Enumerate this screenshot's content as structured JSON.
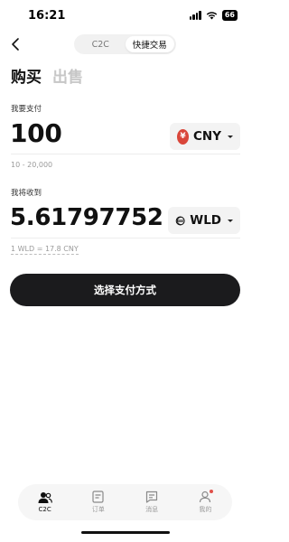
{
  "status_bar": {
    "time": "16:21",
    "battery": "66"
  },
  "top_tabs": [
    "C2C",
    "快捷交易"
  ],
  "mode_tabs": {
    "buy": "购买",
    "sell": "出售"
  },
  "pay": {
    "label": "我要支付",
    "amount": "100",
    "currency": "CNY",
    "currency_symbol": "¥",
    "range": "10 - 20,000"
  },
  "receive": {
    "label": "我将收到",
    "amount": "5.61797752",
    "currency": "WLD",
    "rate": "1 WLD = 17.8 CNY"
  },
  "cta_label": "选择支付方式",
  "bottom_nav": [
    {
      "label": "C2C",
      "icon": "users-icon"
    },
    {
      "label": "订单",
      "icon": "orders-icon"
    },
    {
      "label": "消息",
      "icon": "messages-icon"
    },
    {
      "label": "我的",
      "icon": "profile-icon"
    }
  ],
  "colors": {
    "accent_red": "#d9463a",
    "cta_bg": "#1b1b1d",
    "muted": "#c6c6c6"
  }
}
